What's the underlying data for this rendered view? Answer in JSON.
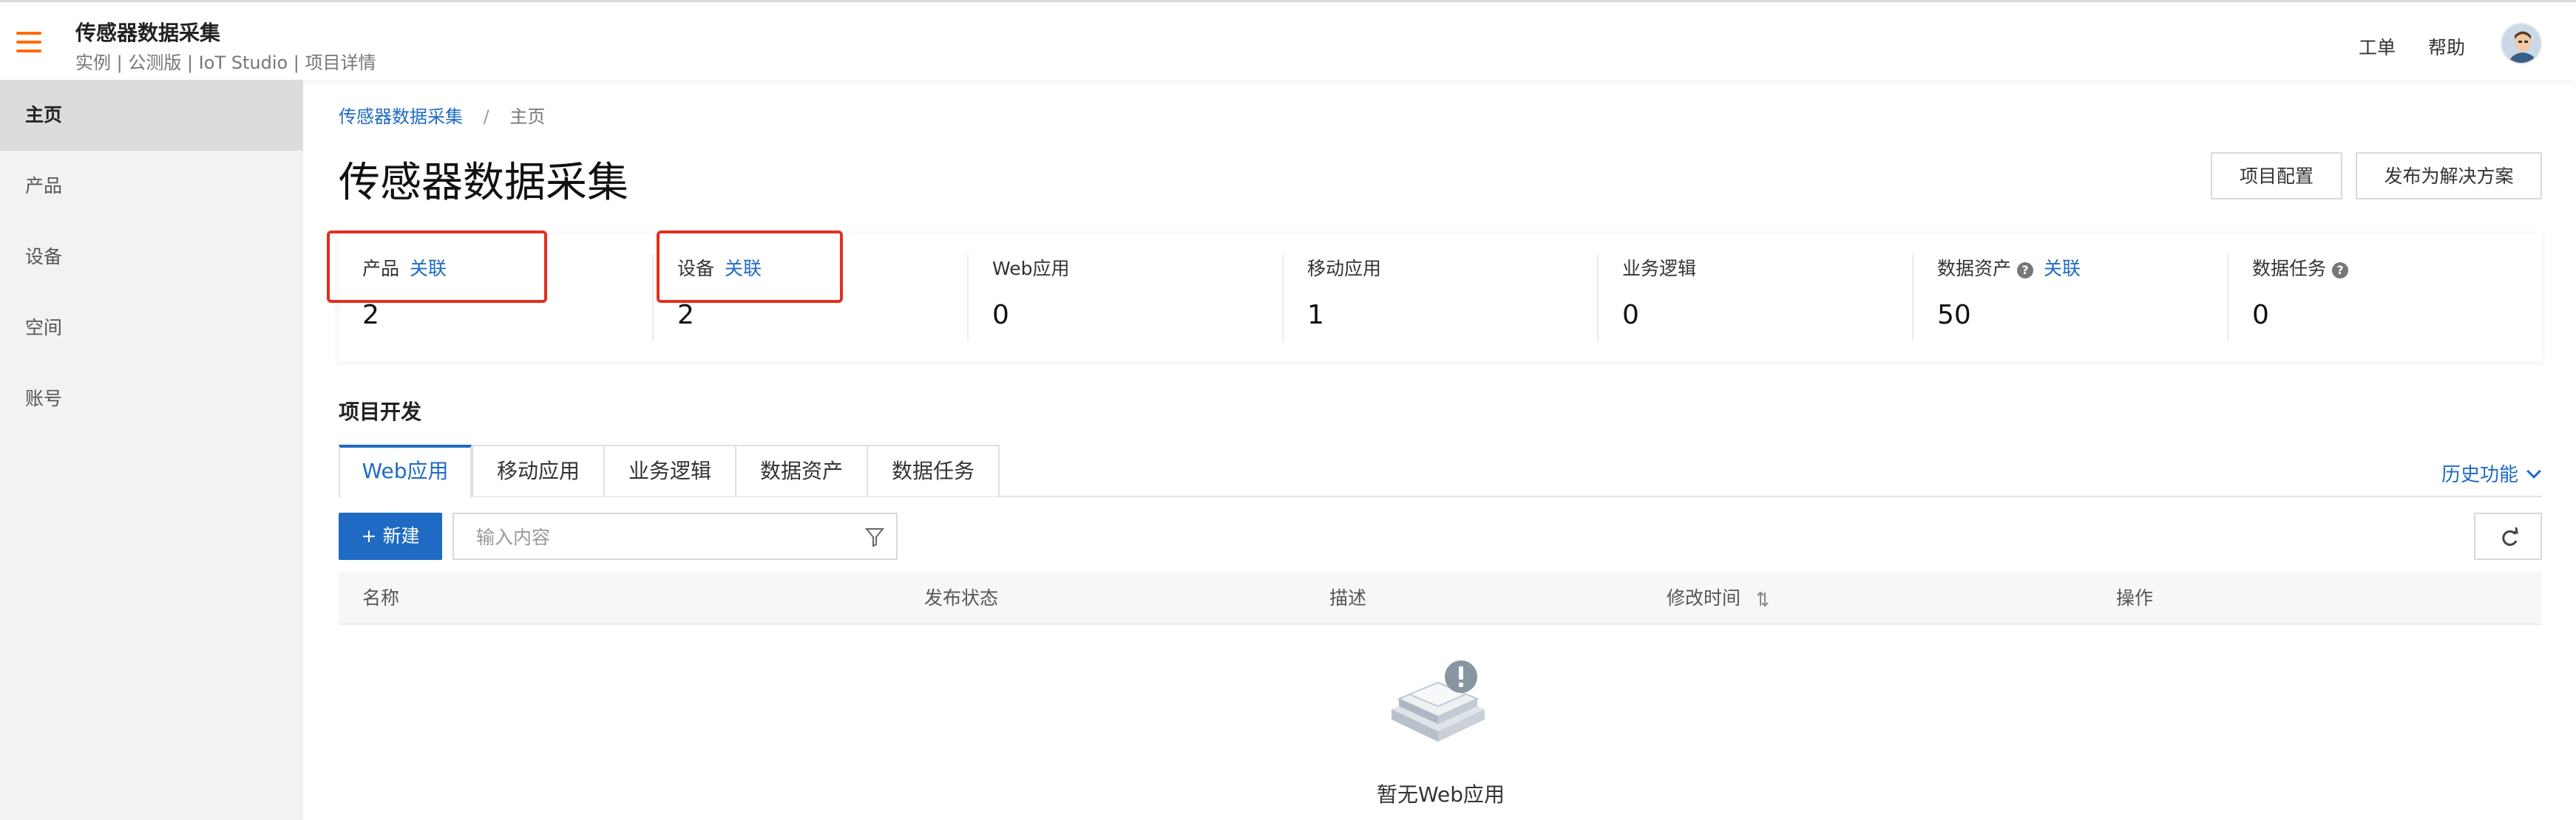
{
  "header": {
    "title": "传感器数据采集",
    "subtitle": "实例 | 公测版 | IoT Studio | 项目详情",
    "links": [
      "工单",
      "帮助"
    ]
  },
  "sidebar": {
    "items": [
      {
        "label": "主页",
        "active": true
      },
      {
        "label": "产品",
        "active": false
      },
      {
        "label": "设备",
        "active": false
      },
      {
        "label": "空间",
        "active": false
      },
      {
        "label": "账号",
        "active": false
      }
    ]
  },
  "breadcrumb": {
    "root": "传感器数据采集",
    "separator": "/",
    "current": "主页"
  },
  "page": {
    "title": "传感器数据采集",
    "buttons": {
      "config": "项目配置",
      "publish": "发布为解决方案"
    }
  },
  "stats": [
    {
      "label": "产品",
      "link": "关联",
      "value": "2"
    },
    {
      "label": "设备",
      "link": "关联",
      "value": "2"
    },
    {
      "label": "Web应用",
      "value": "0"
    },
    {
      "label": "移动应用",
      "value": "1"
    },
    {
      "label": "业务逻辑",
      "value": "0"
    },
    {
      "label": "数据资产",
      "help": true,
      "link": "关联",
      "value": "50"
    },
    {
      "label": "数据任务",
      "help": true,
      "value": "0"
    }
  ],
  "dev": {
    "section_title": "项目开发",
    "tabs": [
      "Web应用",
      "移动应用",
      "业务逻辑",
      "数据资产",
      "数据任务"
    ],
    "active_tab": 0,
    "history_label": "历史功能",
    "new_button": "+ 新建",
    "search_placeholder": "输入内容",
    "table_headers": [
      "名称",
      "发布状态",
      "描述",
      "修改时间",
      "操作"
    ],
    "empty_text": "暂无Web应用"
  },
  "colors": {
    "accent": "#1f6bc3",
    "menu_icon": "#ff6a00",
    "highlight_box": "#e0301e"
  }
}
